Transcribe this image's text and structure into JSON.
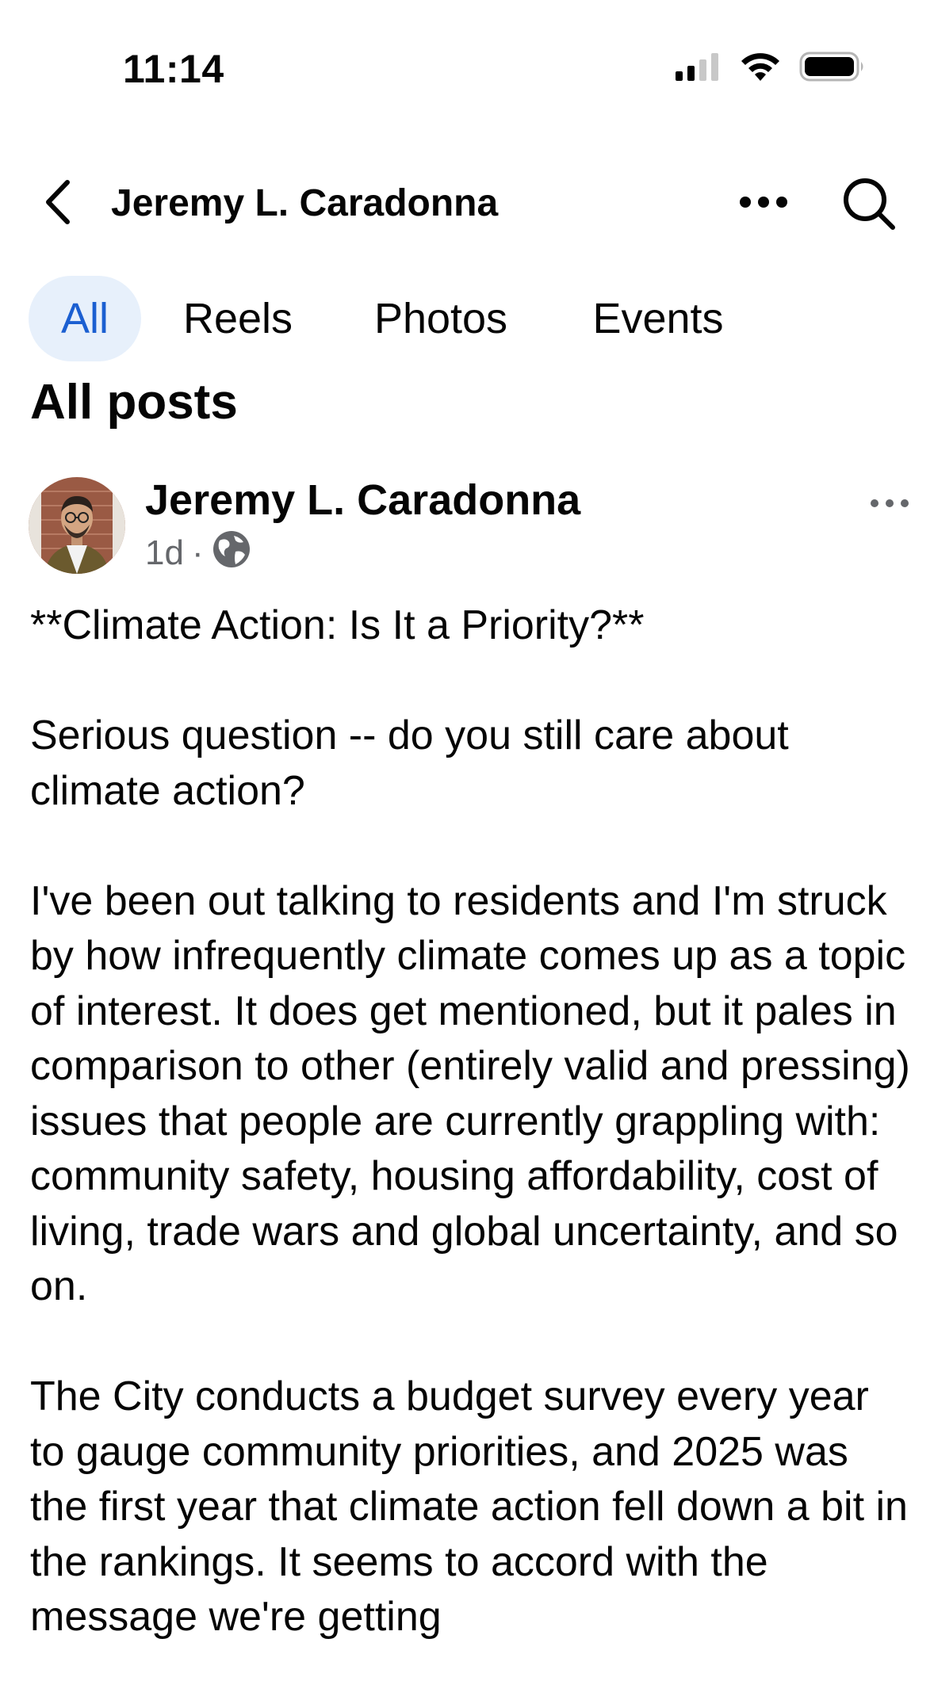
{
  "status_bar": {
    "time": "11:14",
    "icons": [
      "cellular-signal-icon",
      "wifi-icon",
      "battery-icon"
    ]
  },
  "header": {
    "title": "Jeremy L. Caradonna",
    "back_icon": "chevron-left-icon",
    "more_icon": "more-horizontal-icon",
    "search_icon": "search-icon"
  },
  "tabs": [
    {
      "label": "All",
      "active": true
    },
    {
      "label": "Reels",
      "active": false
    },
    {
      "label": "Photos",
      "active": false
    },
    {
      "label": "Events",
      "active": false
    }
  ],
  "section_title": "All posts",
  "post": {
    "author": "Jeremy L. Caradonna",
    "time_ago": "1d",
    "separator": "·",
    "audience_icon": "globe-icon",
    "paragraphs": [
      "**Climate Action: Is It a Priority?**",
      "Serious question -- do you still care about climate action?",
      "I've been out talking to residents and I'm struck by how infrequently climate comes up as a topic of interest. It does get mentioned, but it pales in comparison to other (entirely valid and pressing) issues that people are currently grappling with: community safety, housing affordability, cost of living, trade wars and global uncertainty, and so on.",
      "The City conducts a budget survey every year to gauge community priorities, and 2025 was the first year that climate action fell down a bit in the rankings. It seems to accord with the message we're getting"
    ]
  },
  "colors": {
    "accent": "#1b5fd1",
    "active_tab_bg": "#e7f0fb",
    "secondary_text": "#65676b",
    "text": "#050505"
  }
}
